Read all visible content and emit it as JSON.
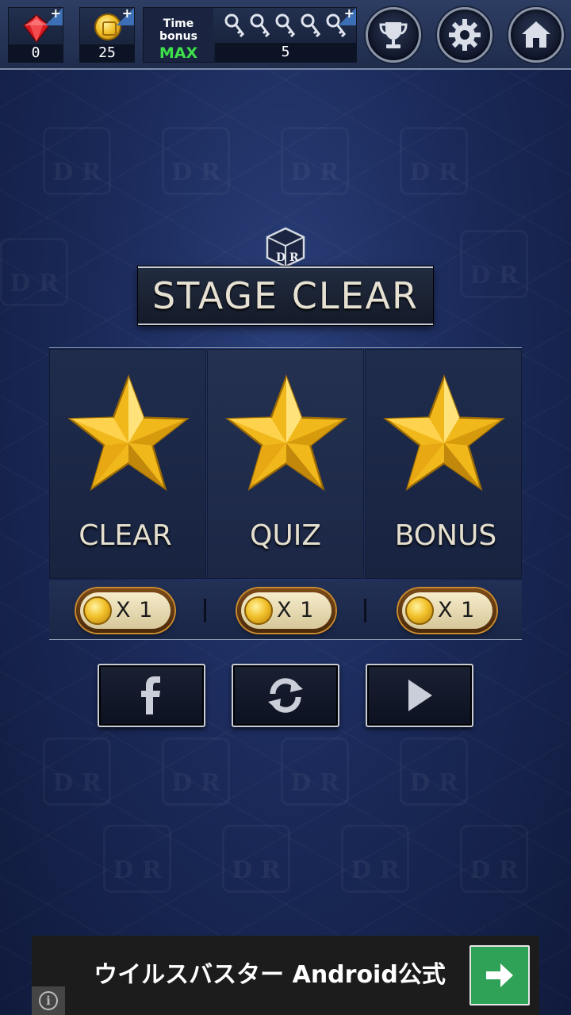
{
  "top_bar": {
    "gems": {
      "icon": "red-gem-icon",
      "value": "0"
    },
    "coins": {
      "icon": "gold-coin-icon",
      "value": "25"
    },
    "time_bonus": {
      "label": "Time bonus",
      "status": "MAX",
      "status_color": "#3ee04a",
      "keys_icon": "key-icon",
      "keys_shown": 5,
      "count": "5"
    },
    "buttons": [
      "trophy-icon",
      "gear-icon",
      "home-icon"
    ]
  },
  "title": "STAGE CLEAR",
  "stars": [
    {
      "label": "CLEAR",
      "icon": "gold-star-icon",
      "reward": "X 1"
    },
    {
      "label": "QUIZ",
      "icon": "gold-star-icon",
      "reward": "X 1"
    },
    {
      "label": "BONUS",
      "icon": "gold-star-icon",
      "reward": "X 1"
    }
  ],
  "actions": [
    "facebook-icon",
    "retry-icon",
    "next-icon"
  ],
  "ad": {
    "text": "ウイルスバスター Android公式",
    "go_icon": "arrow-right-icon",
    "info_icon": "info-icon",
    "info_glyph": "i"
  }
}
